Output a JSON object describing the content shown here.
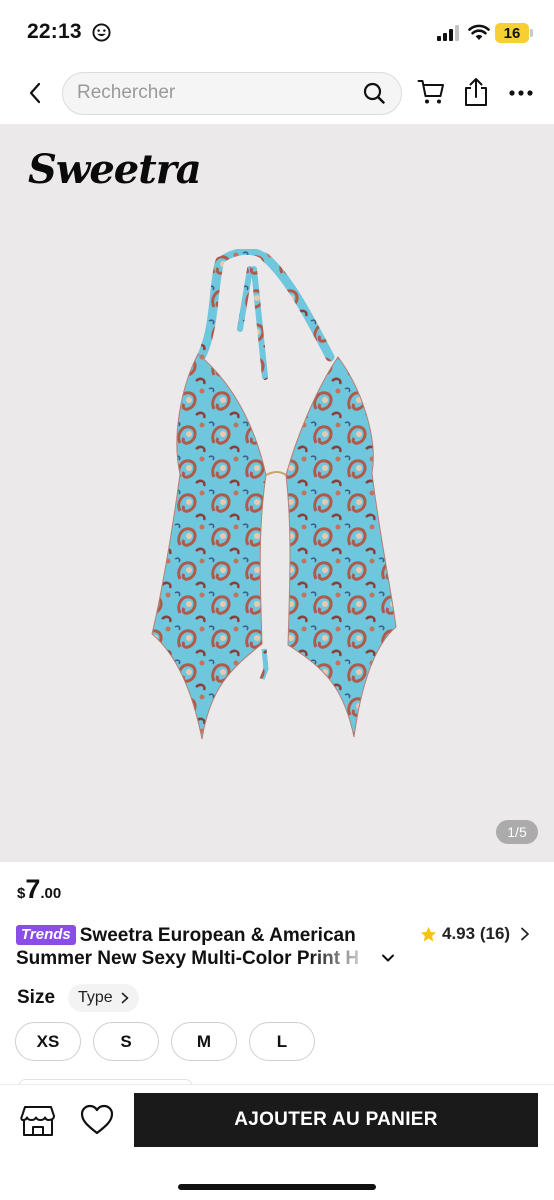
{
  "status_bar": {
    "time": "22:13",
    "battery": "16"
  },
  "search": {
    "placeholder": "Rechercher"
  },
  "hero": {
    "brand": "Sweetra",
    "image_counter": "1/5"
  },
  "product": {
    "price_currency": "$",
    "price_int": "7",
    "price_dec": ".00",
    "badge": "Trends",
    "title_line1": "Sweetra European & American",
    "title_line2": "Summer New Sexy Multi-Color Print H",
    "rating": "4.93",
    "rating_count": "(16)"
  },
  "size": {
    "label": "Size",
    "type_label": "Type",
    "options": [
      "XS",
      "S",
      "M",
      "L"
    ]
  },
  "actions": {
    "add_to_cart": "AJOUTER AU PANIER"
  },
  "colors": {
    "badge_purple": "#8b4de8",
    "star_yellow": "#f6c416",
    "button_dark": "#1a1a1a",
    "battery_yellow": "#f6cf33"
  }
}
